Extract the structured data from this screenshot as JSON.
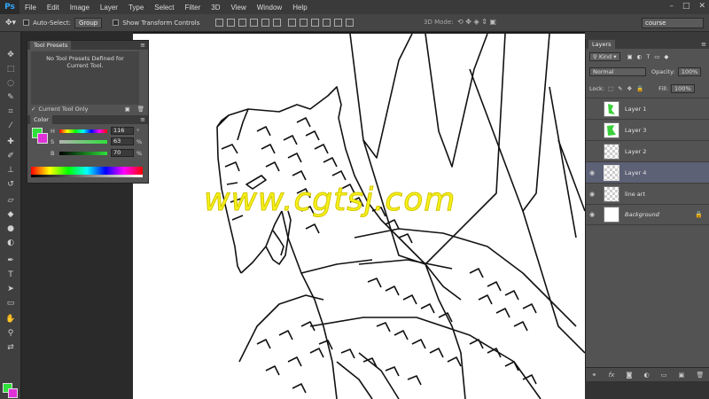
{
  "app": {
    "logo": "Ps"
  },
  "menu": [
    "File",
    "Edit",
    "Image",
    "Layer",
    "Type",
    "Select",
    "Filter",
    "3D",
    "View",
    "Window",
    "Help"
  ],
  "window_controls": [
    "–",
    "□",
    "✕"
  ],
  "options": {
    "auto_select_label": "Auto-Select:",
    "auto_select_value": "Group",
    "transform_label": "Show Transform Controls",
    "mode_3d_label": "3D Mode:",
    "workspace": "course"
  },
  "tool_presets": {
    "title": "Tool Presets",
    "message": "No Tool Presets Defined for Current Tool.",
    "current_tool_only": "Current Tool Only"
  },
  "color_panel": {
    "title": "Color",
    "foreground": "#2ee03a",
    "background": "#e032d8",
    "h_label": "H",
    "h_value": "116",
    "h_unit": "°",
    "s_label": "S",
    "s_value": "63",
    "s_unit": "%",
    "b_label": "B",
    "b_value": "70",
    "b_unit": "%"
  },
  "layers_panel": {
    "title": "Layers",
    "kind_label": "Kind",
    "blend_mode": "Normal",
    "opacity_label": "Opacity:",
    "opacity_value": "100%",
    "lock_label": "Lock:",
    "fill_label": "Fill:",
    "fill_value": "100%",
    "layers": [
      {
        "name": "Layer 1",
        "visible": false,
        "selected": false,
        "thumb": "green"
      },
      {
        "name": "Layer 3",
        "visible": false,
        "selected": false,
        "thumb": "green"
      },
      {
        "name": "Layer 2",
        "visible": false,
        "selected": false,
        "thumb": "empty"
      },
      {
        "name": "Layer 4",
        "visible": true,
        "selected": true,
        "thumb": "empty"
      },
      {
        "name": "line art",
        "visible": true,
        "selected": false,
        "thumb": "empty"
      },
      {
        "name": "Background",
        "visible": true,
        "selected": false,
        "thumb": "white",
        "locked": true
      }
    ],
    "footer_icons": [
      "link-icon",
      "fx-icon",
      "mask-icon",
      "adjustment-icon",
      "folder-icon",
      "new-layer-icon",
      "trash-icon"
    ]
  },
  "watermark": "www.cgtsj.com"
}
